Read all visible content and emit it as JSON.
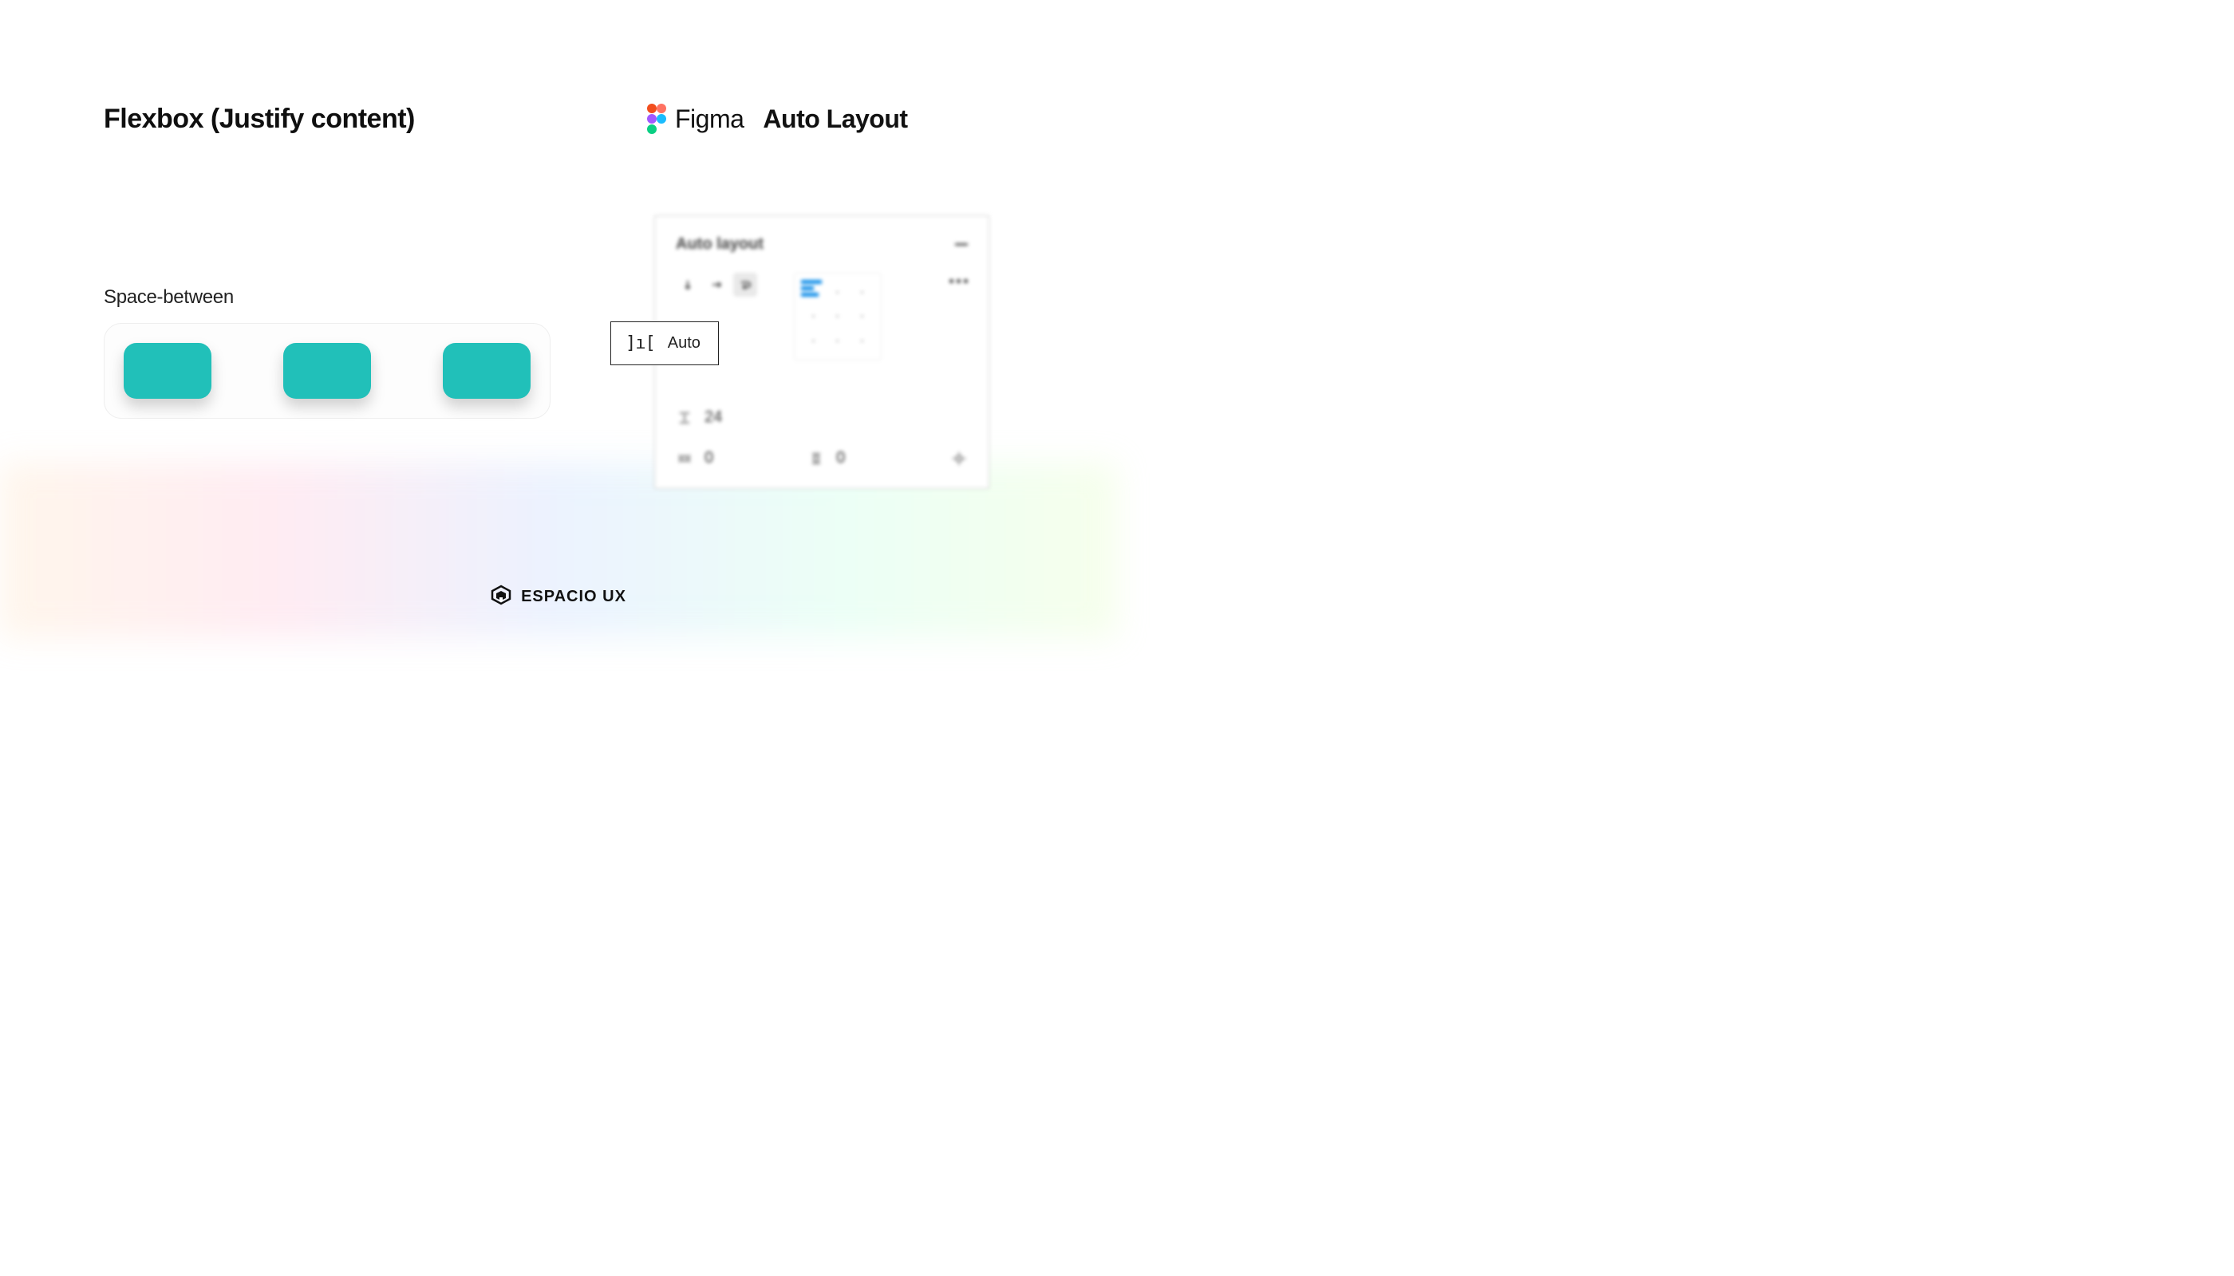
{
  "left": {
    "title": "Flexbox (Justify content)",
    "subtitle": "Space-between"
  },
  "right": {
    "figma_label": "Figma",
    "autolayout_label": "Auto Layout"
  },
  "panel": {
    "title": "Auto layout",
    "gap_value": "Auto",
    "vertical_gap_value": "24",
    "padding_h": "0",
    "padding_v": "0"
  },
  "footer": {
    "brand": "ESPACIO UX"
  },
  "colors": {
    "teal": "#21c0b9",
    "figma_blue": "#0d8ce8"
  }
}
